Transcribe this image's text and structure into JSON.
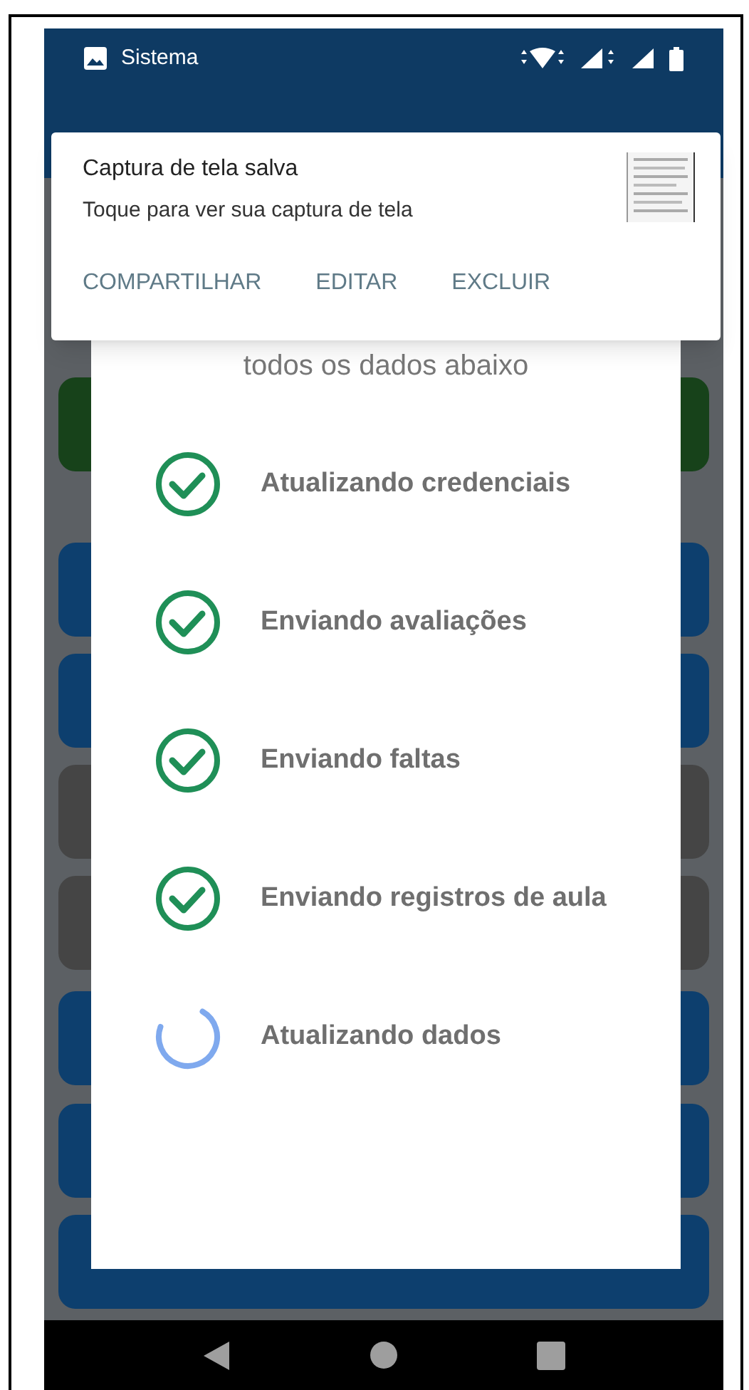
{
  "status_bar": {
    "app": "Sistema"
  },
  "notification": {
    "title": "Captura de tela salva",
    "text": "Toque para ver sua captura de tela",
    "actions": [
      "COMPARTILHAR",
      "EDITAR",
      "EXCLUIR"
    ]
  },
  "dialog": {
    "subtitle": "todos os dados abaixo",
    "tasks": [
      {
        "label": "Atualizando credenciais",
        "kind": "done"
      },
      {
        "label": "Enviando avaliações",
        "kind": "done"
      },
      {
        "label": "Enviando faltas",
        "kind": "done"
      },
      {
        "label": "Enviando registros de aula",
        "kind": "done"
      },
      {
        "label": "Atualizando dados",
        "kind": "loading"
      }
    ]
  }
}
